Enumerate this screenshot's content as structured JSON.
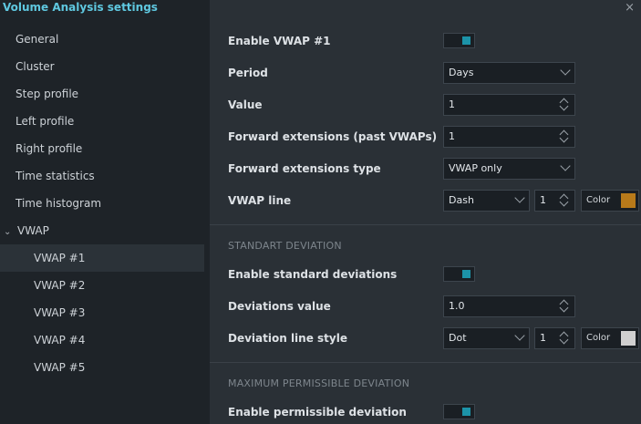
{
  "window": {
    "title": "Volume Analysis settings",
    "close_glyph": "×"
  },
  "sidebar": {
    "items": [
      {
        "label": "General"
      },
      {
        "label": "Cluster"
      },
      {
        "label": "Step profile"
      },
      {
        "label": "Left profile"
      },
      {
        "label": "Right profile"
      },
      {
        "label": "Time statistics"
      },
      {
        "label": "Time histogram"
      },
      {
        "label": "VWAP",
        "expanded": true
      },
      {
        "label": "VWAP #1",
        "active": true
      },
      {
        "label": "VWAP #2"
      },
      {
        "label": "VWAP #3"
      },
      {
        "label": "VWAP #4"
      },
      {
        "label": "VWAP #5"
      }
    ]
  },
  "settings": {
    "enable_vwap": {
      "label": "Enable VWAP #1",
      "on": true
    },
    "period": {
      "label": "Period",
      "value": "Days"
    },
    "value": {
      "label": "Value",
      "value": "1"
    },
    "forward_ext": {
      "label": "Forward extensions (past VWAPs)",
      "value": "1"
    },
    "forward_ext_type": {
      "label": "Forward extensions type",
      "value": "VWAP only"
    },
    "vwap_line": {
      "label": "VWAP line",
      "style": "Dash",
      "width": "1",
      "color_label": "Color",
      "color": "#b87a1a"
    }
  },
  "std_dev": {
    "heading": "STANDART DEVIATION",
    "enable": {
      "label": "Enable standard deviations",
      "on": true
    },
    "value": {
      "label": "Deviations value",
      "value": "1.0"
    },
    "line_style": {
      "label": "Deviation line style",
      "style": "Dot",
      "width": "1",
      "color_label": "Color",
      "color": "#d0d0d0"
    }
  },
  "max_dev": {
    "heading": "MAXIMUM PERMISSIBLE DEVIATION",
    "enable": {
      "label": "Enable permissible deviation",
      "on": true
    }
  },
  "colors": {
    "accent": "#1c93a8",
    "title": "#5fc8e0"
  }
}
